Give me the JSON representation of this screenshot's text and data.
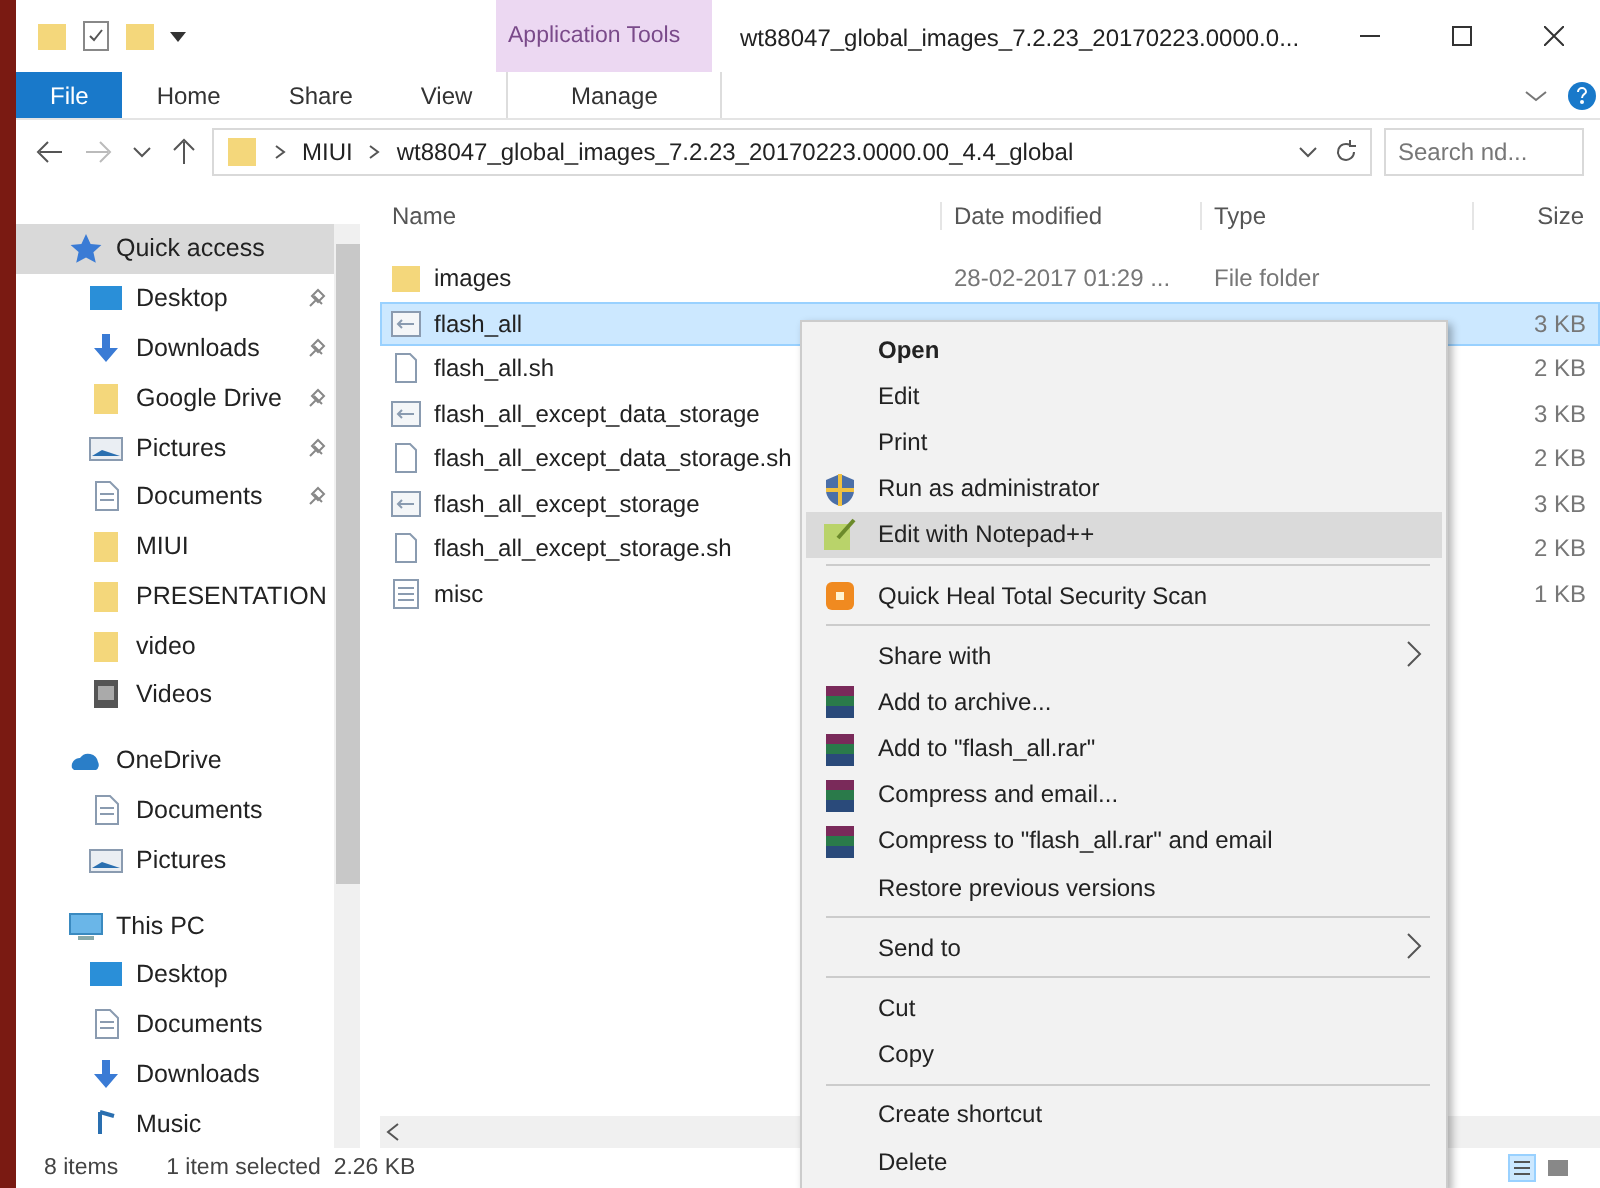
{
  "window": {
    "title": "wt88047_global_images_7.2.23_20170223.0000.0...",
    "context_tab": "Application Tools"
  },
  "ribbon_tabs": [
    {
      "label": "File",
      "kind": "file",
      "selected": false
    },
    {
      "label": "Home",
      "kind": "tab",
      "selected": false
    },
    {
      "label": "Share",
      "kind": "tab",
      "selected": false
    },
    {
      "label": "View",
      "kind": "tab",
      "selected": false
    },
    {
      "label": "Manage",
      "kind": "context",
      "selected": true
    }
  ],
  "address": {
    "back_disabled": false,
    "forward_disabled": true,
    "crumbs": [
      "MIUI",
      "wt88047_global_images_7.2.23_20170223.0000.00_4.4_global"
    ],
    "search": {
      "placeholder": "Search nd..."
    }
  },
  "sidebar": {
    "items": [
      {
        "label": "Quick access",
        "kind": "star",
        "selected": true,
        "children": [
          {
            "label": "Desktop",
            "kind": "desktop",
            "pinned": true,
            "selected": false
          },
          {
            "label": "Downloads",
            "kind": "download",
            "pinned": true,
            "selected": false
          },
          {
            "label": "Google Drive",
            "kind": "folder",
            "pinned": true,
            "selected": false
          },
          {
            "label": "Pictures",
            "kind": "pictures",
            "pinned": true,
            "selected": false
          },
          {
            "label": "Documents",
            "kind": "documents",
            "pinned": true,
            "selected": false
          },
          {
            "label": "MIUI",
            "kind": "folder",
            "pinned": false,
            "selected": false
          },
          {
            "label": "PRESENTATION",
            "kind": "folder",
            "pinned": false,
            "selected": false
          },
          {
            "label": "video",
            "kind": "folder",
            "pinned": false,
            "selected": false
          },
          {
            "label": "Videos",
            "kind": "videos",
            "pinned": false,
            "selected": false
          }
        ]
      },
      {
        "label": "OneDrive",
        "kind": "cloud",
        "selected": false,
        "children": [
          {
            "label": "Documents",
            "kind": "documents",
            "pinned": false,
            "selected": false
          },
          {
            "label": "Pictures",
            "kind": "pictures",
            "pinned": false,
            "selected": false
          }
        ]
      },
      {
        "label": "This PC",
        "kind": "pc",
        "selected": false,
        "children": [
          {
            "label": "Desktop",
            "kind": "desktop",
            "pinned": false,
            "selected": false
          },
          {
            "label": "Documents",
            "kind": "documents",
            "pinned": false,
            "selected": false
          },
          {
            "label": "Downloads",
            "kind": "download",
            "pinned": false,
            "selected": false
          },
          {
            "label": "Music",
            "kind": "music",
            "pinned": false,
            "selected": false
          }
        ]
      }
    ]
  },
  "table": {
    "columns": [
      "Name",
      "Date modified",
      "Type",
      "Size"
    ],
    "rows": [
      {
        "name": "images",
        "kind": "folder",
        "date": "28-02-2017 01:29 ...",
        "type": "File folder",
        "size": "",
        "selected": false
      },
      {
        "name": "flash_all",
        "kind": "script",
        "date": "",
        "type": "",
        "size": "3 KB",
        "selected": true
      },
      {
        "name": "flash_all.sh",
        "kind": "file",
        "date": "",
        "type": "",
        "size": "2 KB",
        "selected": false
      },
      {
        "name": "flash_all_except_data_storage",
        "kind": "script",
        "date": "",
        "type": "",
        "size": "3 KB",
        "selected": false
      },
      {
        "name": "flash_all_except_data_storage.sh",
        "kind": "file",
        "date": "",
        "type": "",
        "size": "2 KB",
        "selected": false
      },
      {
        "name": "flash_all_except_storage",
        "kind": "script",
        "date": "",
        "type": "",
        "size": "3 KB",
        "selected": false
      },
      {
        "name": "flash_all_except_storage.sh",
        "kind": "file",
        "date": "",
        "type": "",
        "size": "2 KB",
        "selected": false
      },
      {
        "name": "misc",
        "kind": "text",
        "date": "",
        "type": "",
        "size": "1 KB",
        "selected": false
      }
    ]
  },
  "context_menu": [
    {
      "label": "Open",
      "kind": "default",
      "selected": false
    },
    {
      "label": "Edit",
      "kind": "plain",
      "selected": false
    },
    {
      "label": "Print",
      "kind": "plain",
      "selected": false
    },
    {
      "label": "Run as administrator",
      "kind": "shield",
      "selected": false
    },
    {
      "label": "Edit with Notepad++",
      "kind": "notepad",
      "selected": true
    },
    {
      "kind": "separator"
    },
    {
      "label": "Quick Heal Total Security Scan",
      "kind": "scan",
      "selected": false
    },
    {
      "kind": "separator"
    },
    {
      "label": "Share with",
      "kind": "submenu",
      "selected": false
    },
    {
      "label": "Add to archive...",
      "kind": "archive",
      "selected": false
    },
    {
      "label": "Add to \"flash_all.rar\"",
      "kind": "archive",
      "selected": false
    },
    {
      "label": "Compress and email...",
      "kind": "archive",
      "selected": false
    },
    {
      "label": "Compress to \"flash_all.rar\" and email",
      "kind": "archive",
      "selected": false
    },
    {
      "label": "Restore previous versions",
      "kind": "plain",
      "selected": false
    },
    {
      "kind": "separator"
    },
    {
      "label": "Send to",
      "kind": "submenu",
      "selected": false
    },
    {
      "kind": "separator"
    },
    {
      "label": "Cut",
      "kind": "plain",
      "selected": false
    },
    {
      "label": "Copy",
      "kind": "plain",
      "selected": false
    },
    {
      "kind": "separator"
    },
    {
      "label": "Create shortcut",
      "kind": "plain",
      "selected": false
    },
    {
      "label": "Delete",
      "kind": "plain",
      "selected": false
    }
  ],
  "status_bar": {
    "count": "8 items",
    "selection": "1 item selected  2.26 KB"
  }
}
